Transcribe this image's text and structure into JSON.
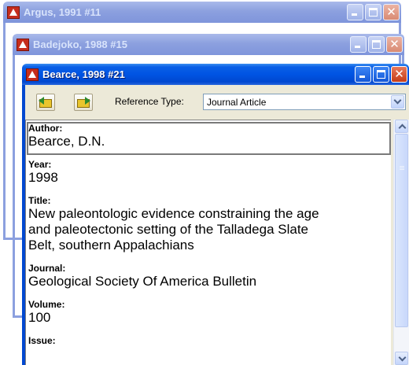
{
  "windows": [
    {
      "title": "Argus, 1991 #11",
      "state": "inactive"
    },
    {
      "title": "Badejoko, 1988 #15",
      "state": "inactive"
    },
    {
      "title": "Bearce, 1998 #21",
      "state": "active"
    }
  ],
  "toolbar": {
    "prev_icon": "previous-reference-icon",
    "next_icon": "next-reference-icon",
    "reference_type_label": "Reference Type:",
    "reference_type_value": "Journal Article"
  },
  "fields": {
    "author": {
      "label": "Author:",
      "value": "Bearce, D.N."
    },
    "year": {
      "label": "Year:",
      "value": "1998"
    },
    "title": {
      "label": "Title:",
      "lines": [
        "New paleontologic evidence constraining the age",
        "and paleotectonic setting of the Talladega Slate",
        "Belt, southern Appalachians"
      ]
    },
    "journal": {
      "label": "Journal:",
      "value": "Geological Society Of America Bulletin"
    },
    "volume": {
      "label": "Volume:",
      "value": "100"
    },
    "issue": {
      "label": "Issue:",
      "value": ""
    }
  },
  "colors": {
    "active_title": "#0054e3",
    "inactive_title": "#8ca0df",
    "close_button": "#c63d18",
    "toolbar_bg": "#ece9d8"
  }
}
